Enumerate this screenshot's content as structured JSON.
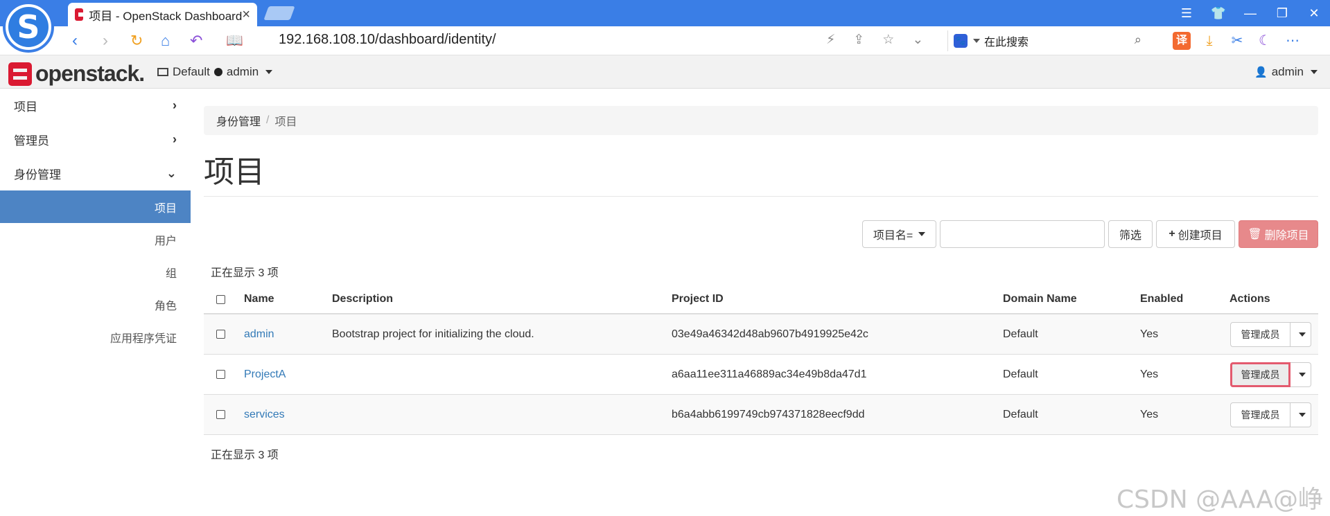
{
  "browser": {
    "tab_title": "项目 - OpenStack Dashboard",
    "tab_close": "×",
    "url": "192.168.108.10/dashboard/identity/",
    "search_label": "在此搜索",
    "translate_label": "译",
    "window_controls": [
      "☰",
      "👕",
      "—",
      "❐",
      "✕"
    ]
  },
  "header": {
    "logo_text": "openstack.",
    "domain": "Default",
    "project": "admin",
    "user": "admin"
  },
  "sidebar": {
    "top_items": [
      {
        "label": "项目",
        "chevron": "›"
      },
      {
        "label": "管理员",
        "chevron": "›"
      },
      {
        "label": "身份管理",
        "chevron": "⌄"
      }
    ],
    "sub_items": [
      {
        "label": "项目",
        "active": true
      },
      {
        "label": "用户"
      },
      {
        "label": "组"
      },
      {
        "label": "角色"
      },
      {
        "label": "应用程序凭证"
      }
    ]
  },
  "breadcrumb": {
    "parent": "身份管理",
    "separator": "/",
    "current": "项目"
  },
  "page_title": "项目",
  "filter": {
    "field_label": "项目名=",
    "input_value": "",
    "filter_button": "筛选",
    "create_button": "创建项目",
    "delete_button": "删除项目"
  },
  "count_text": "正在显示 3 项",
  "table": {
    "headers": [
      "Name",
      "Description",
      "Project ID",
      "Domain Name",
      "Enabled",
      "Actions"
    ],
    "rows": [
      {
        "name": "admin",
        "description": "Bootstrap project for initializing the cloud.",
        "project_id": "03e49a46342d48ab9607b4919925e42c",
        "domain": "Default",
        "enabled": "Yes",
        "action": "管理成员"
      },
      {
        "name": "ProjectA",
        "description": "",
        "project_id": "a6aa11ee311a46889ac34e49b8da47d1",
        "domain": "Default",
        "enabled": "Yes",
        "action": "管理成员"
      },
      {
        "name": "services",
        "description": "",
        "project_id": "b6a4abb6199749cb974371828eecf9dd",
        "domain": "Default",
        "enabled": "Yes",
        "action": "管理成员"
      }
    ]
  },
  "watermark": "CSDN @AAA@峥"
}
